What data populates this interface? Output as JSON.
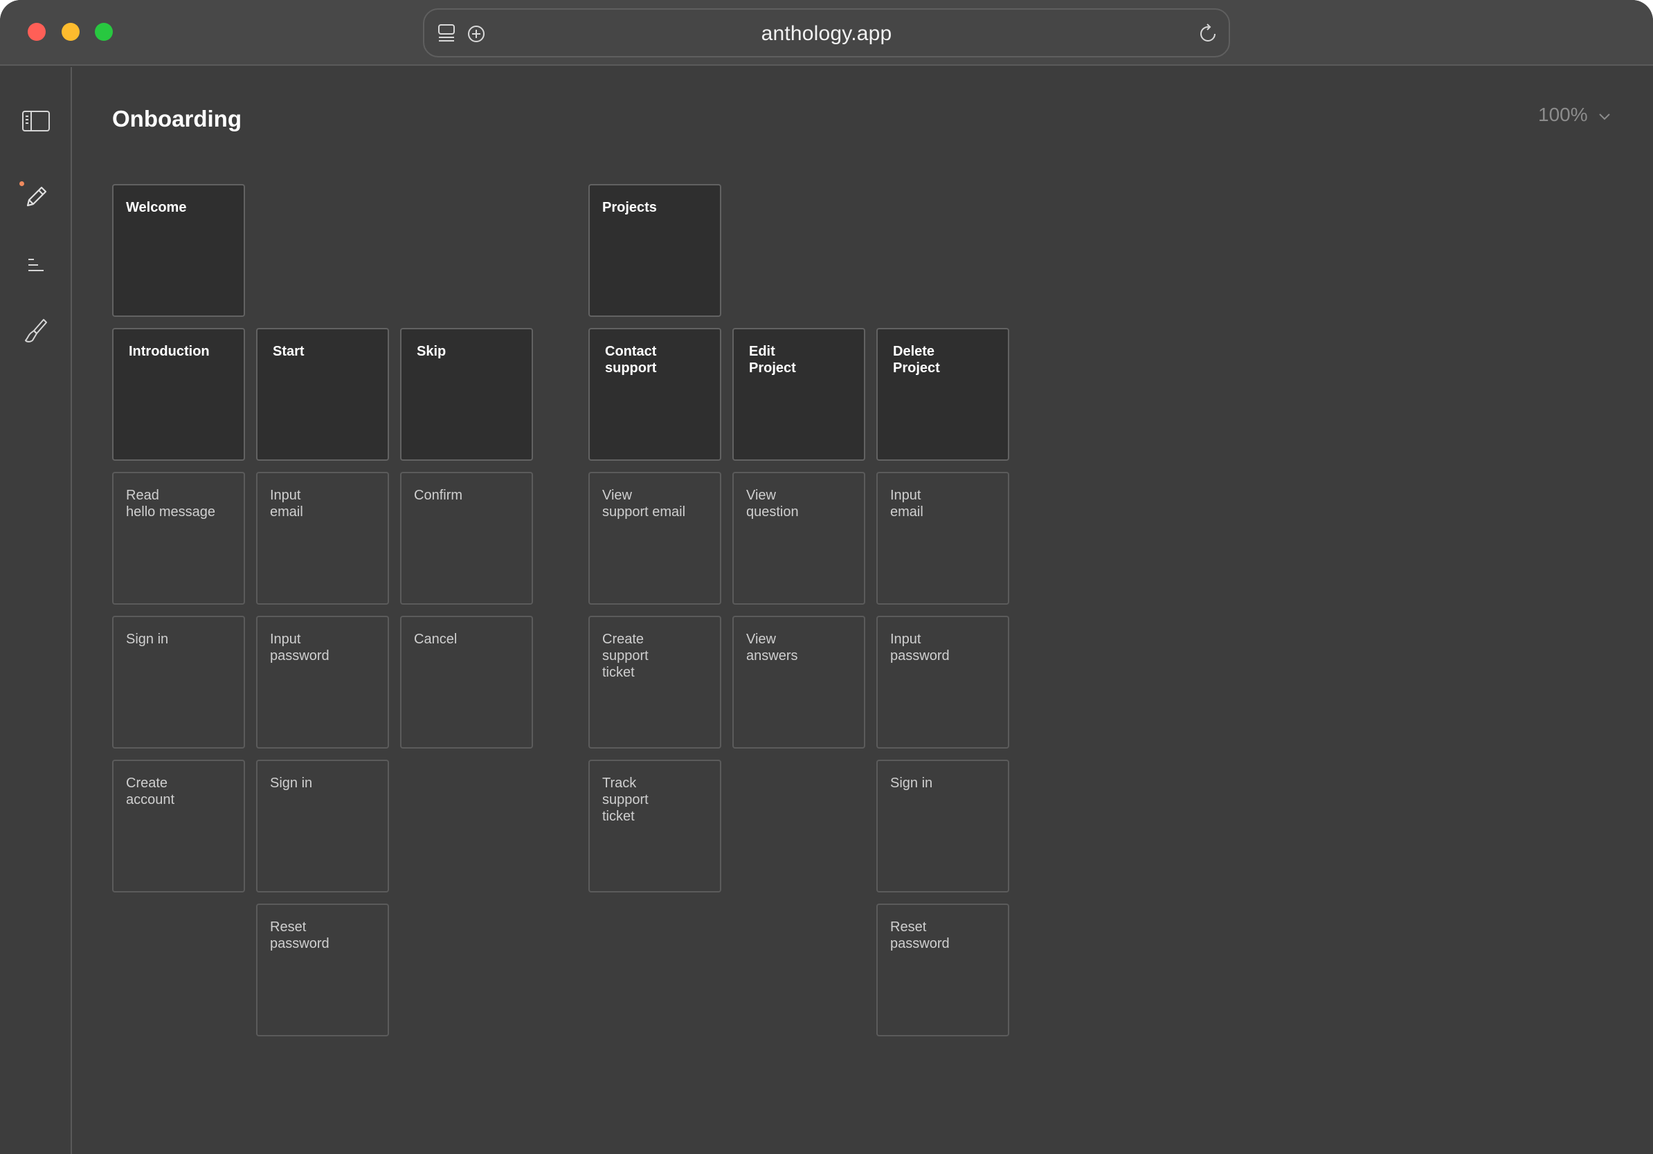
{
  "browser": {
    "url": "anthology.app",
    "icons": {
      "tabs": "tabs-overview-icon",
      "new_tab": "plus-circle-icon",
      "reload": "reload-icon"
    }
  },
  "sidebar": {
    "items": [
      {
        "name": "sidebar-toggle-icon"
      },
      {
        "name": "pencil-icon",
        "active": true
      },
      {
        "name": "align-left-icon"
      },
      {
        "name": "brush-icon"
      }
    ],
    "accent_color": "#ef8a5e"
  },
  "page": {
    "title": "Onboarding",
    "zoom": "100%"
  },
  "cards": {
    "welcome": "Welcome",
    "projects": "Projects",
    "introduction": "Introduction",
    "start": "Start",
    "skip": "Skip",
    "contact_support": "Contact\nsupport",
    "edit_project": "Edit\nProject",
    "delete_project": "Delete\nProject",
    "read_hello": "Read\nhello message",
    "input_email_1": "Input\nemail",
    "confirm": "Confirm",
    "view_support_email": "View\nsupport email",
    "view_question": "View\nquestion",
    "input_email_2": "Input\nemail",
    "sign_in_1": "Sign in",
    "input_password_1": "Input\npassword",
    "cancel": "Cancel",
    "create_support_ticket": "Create\nsupport\nticket",
    "view_answers": "View\nanswers",
    "input_password_2": "Input\npassword",
    "create_account": "Create\naccount",
    "sign_in_2": "Sign in",
    "track_support_ticket": "Track\nsupport\nticket",
    "sign_in_3": "Sign in",
    "reset_password_1": "Reset\npassword",
    "reset_password_2": "Reset\npassword"
  }
}
